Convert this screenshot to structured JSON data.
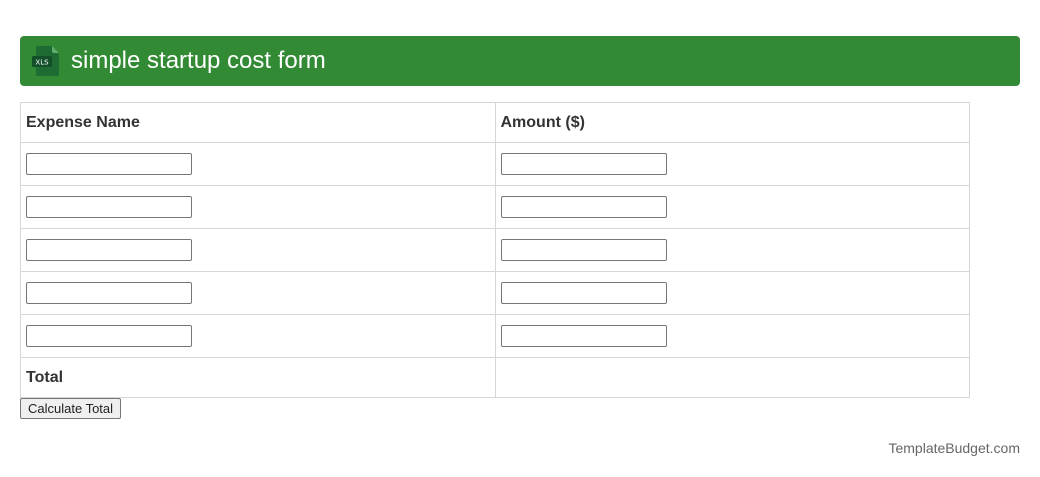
{
  "header": {
    "title": "simple startup cost form",
    "icon": "xls-file-icon",
    "icon_text": "XLS",
    "color": "#338a35"
  },
  "table": {
    "columns": [
      "Expense Name",
      "Amount ($)"
    ],
    "rows": [
      {
        "name": "",
        "amount": ""
      },
      {
        "name": "",
        "amount": ""
      },
      {
        "name": "",
        "amount": ""
      },
      {
        "name": "",
        "amount": ""
      },
      {
        "name": "",
        "amount": ""
      }
    ],
    "total_label": "Total",
    "total_value": ""
  },
  "actions": {
    "calculate_label": "Calculate Total"
  },
  "footer": {
    "brand": "TemplateBudget.com"
  }
}
